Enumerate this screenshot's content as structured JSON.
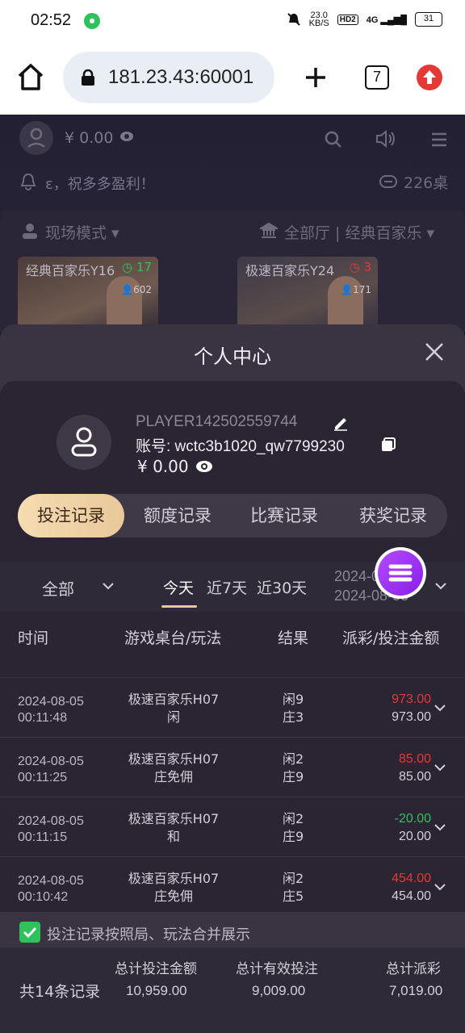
{
  "status_bar": {
    "time": "02:52",
    "net_speed": "23.0",
    "net_unit": "KB/S",
    "hd": "HD2",
    "signal": "4G",
    "battery": "31"
  },
  "browser": {
    "url": "181.23.43:60001",
    "tab_count": "7"
  },
  "background": {
    "balance": "¥ 0.00",
    "notice": "ε，祝多多盈利！",
    "tables": "226桌",
    "mode": "现场模式",
    "hall": "全部厅 | 经典百家乐",
    "games": [
      {
        "name": "经典百家乐Y16",
        "count": "17",
        "users": "602",
        "count_color": "#2fc25b"
      },
      {
        "name": "极速百家乐Y24",
        "count": "3",
        "users": "171",
        "count_color": "#e53935"
      }
    ]
  },
  "sheet": {
    "title": "个人中心",
    "player": "PLAYER142502559744",
    "account": "账号: wctc3b1020_qw7799230",
    "balance": "¥ 0.00",
    "tabs": [
      "投注记录",
      "额度记录",
      "比赛记录",
      "获奖记录"
    ],
    "filter": {
      "all": "全部",
      "periods": [
        "今天",
        "近7天",
        "近30天"
      ],
      "date_from": "2024-08-05",
      "date_to": "2024-08-05"
    },
    "headers": [
      "时间",
      "游戏桌台/玩法",
      "结果",
      "派彩/投注金额"
    ],
    "rows": [
      {
        "date": "2024-08-05",
        "time": "00:11:48",
        "game": "极速百家乐H07",
        "play": "闲",
        "r1": "闲9",
        "r2": "庄3",
        "payout": "973.00",
        "bet": "973.00",
        "color": "#e53935"
      },
      {
        "date": "2024-08-05",
        "time": "00:11:25",
        "game": "极速百家乐H07",
        "play": "庄免佣",
        "r1": "闲2",
        "r2": "庄9",
        "payout": "85.00",
        "bet": "85.00",
        "color": "#e53935"
      },
      {
        "date": "2024-08-05",
        "time": "00:11:15",
        "game": "极速百家乐H07",
        "play": "和",
        "r1": "闲2",
        "r2": "庄9",
        "payout": "-20.00",
        "bet": "20.00",
        "color": "#2fc25b"
      },
      {
        "date": "2024-08-05",
        "time": "00:10:42",
        "game": "极速百家乐H07",
        "play": "庄免佣",
        "r1": "闲2",
        "r2": "庄5",
        "payout": "454.00",
        "bet": "454.00",
        "color": "#e53935"
      }
    ],
    "merge_label": "投注记录按照局、玩法合并展示",
    "summary": {
      "count": "共14条记录",
      "labels": [
        "总计投注金额",
        "总计有效投注",
        "总计派彩"
      ],
      "values": [
        "10,959.00",
        "9,009.00",
        "7,019.00"
      ]
    }
  }
}
